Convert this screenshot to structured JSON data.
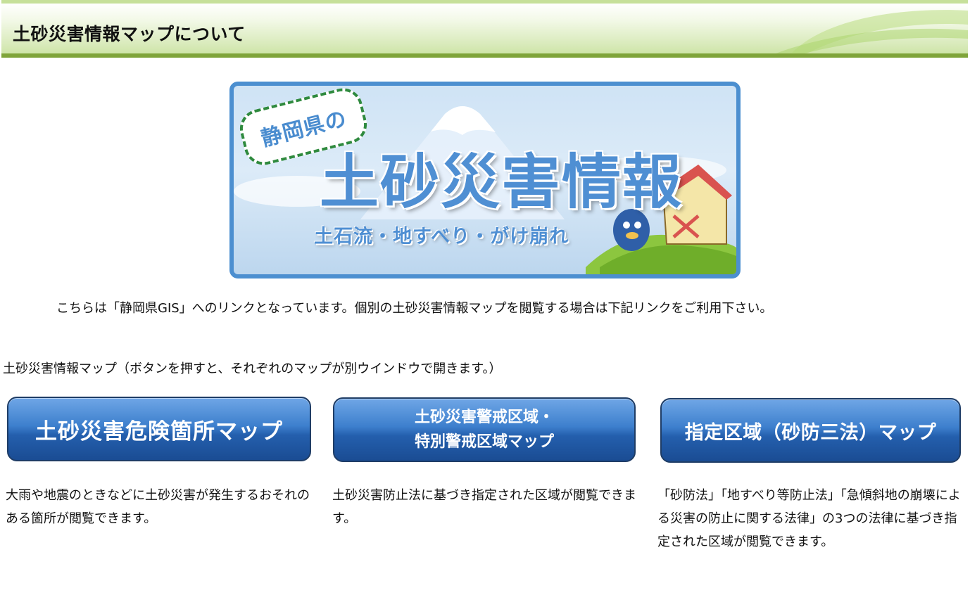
{
  "header": {
    "title": "土砂災害情報マップについて"
  },
  "banner": {
    "badge_text": "静岡県の",
    "title_text": "土砂災害情報",
    "subtitle_text": "土石流・地すべり・がけ崩れ"
  },
  "intro": {
    "text": "こちらは「静岡県GIS」へのリンクとなっています。個別の土砂災害情報マップを閲覧する場合は下記リンクをご利用下さい。"
  },
  "section": {
    "label": "土砂災害情報マップ（ボタンを押すと、それぞれのマップが別ウインドウで開きます。）"
  },
  "maps": [
    {
      "button_label": "土砂災害危険箇所マップ",
      "description": "大雨や地震のときなどに土砂災害が発生するおそれのある箇所が閲覧できます。"
    },
    {
      "button_label_line1": "土砂災害警戒区域・",
      "button_label_line2": "特別警戒区域マップ",
      "description": "土砂災害防止法に基づき指定された区域が閲覧できます。"
    },
    {
      "button_label": "指定区域（砂防三法）マップ",
      "description": "「砂防法」「地すべり等防止法」「急傾斜地の崩壊による災害の防止に関する法律」の3つの法律に基づき指定された区域が閲覧できます。"
    }
  ],
  "colors": {
    "header_rule": "#7fa43a",
    "banner_border": "#4c8fd0",
    "button_top": "#6fa6e6",
    "button_bottom": "#1a4c93"
  }
}
